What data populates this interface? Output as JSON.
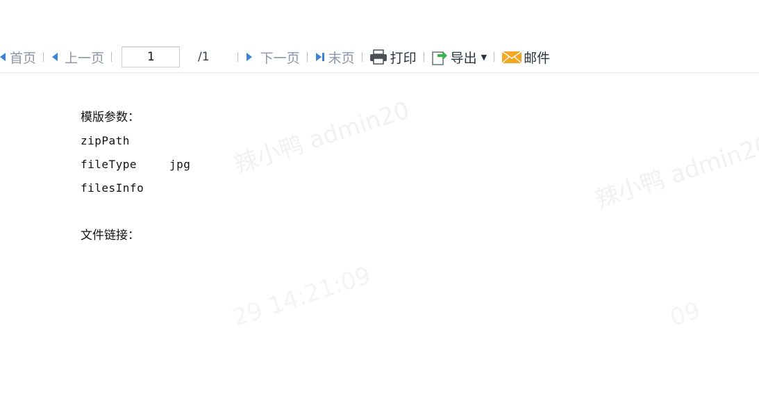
{
  "toolbar": {
    "first_page": "首页",
    "prev_page": "上一页",
    "page_current": "1",
    "page_total": "/1",
    "next_page": "下一页",
    "last_page": "末页",
    "print": "打印",
    "export": "导出",
    "mail": "邮件"
  },
  "content": {
    "template_params_label": "模版参数：",
    "params": [
      {
        "key": "zipPath",
        "value": ""
      },
      {
        "key": "fileType",
        "value": "jpg"
      },
      {
        "key": "filesInfo",
        "value": ""
      }
    ],
    "file_link_label": "文件链接："
  },
  "watermark": {
    "user": "辣小鸭 admin20",
    "user2": "辣小鸭 admin20",
    "time": "29 14:21:09",
    "time2": "09"
  },
  "colors": {
    "print_icon": "#4a4f57",
    "export_icon_green": "#3bb54a",
    "mail_icon": "#f5a623",
    "nav_arrow": "#3b82d8"
  }
}
